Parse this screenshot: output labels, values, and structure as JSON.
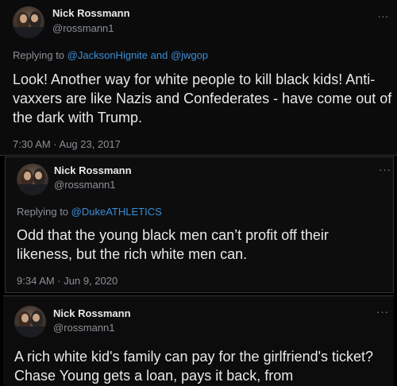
{
  "tweets": [
    {
      "name": "Nick Rossmann",
      "handle": "@rossmann1",
      "more": "...",
      "replying_prefix": "Replying to",
      "replying_to": "@JacksonHignite and @jwgop",
      "text": "Look! Another way for white people to kill black kids! Anti-vaxxers are like Nazis and Confederates - have come out of the dark with Trump.",
      "timestamp": "7:30 AM · Aug 23, 2017"
    },
    {
      "name": "Nick Rossmann",
      "handle": "@rossmann1",
      "more": "···",
      "replying_prefix": "Replying to",
      "replying_to": "@DukeATHLETICS",
      "text": "Odd that the young black men can’t profit off their likeness, but the rich white men can.",
      "timestamp": "9:34 AM · Jun 9, 2020"
    },
    {
      "name": "Nick Rossmann",
      "handle": "@rossmann1",
      "more": "···",
      "text": "A rich white kid's family can pay for the girlfriend's ticket? Chase Young gets a loan, pays it back, from"
    }
  ]
}
